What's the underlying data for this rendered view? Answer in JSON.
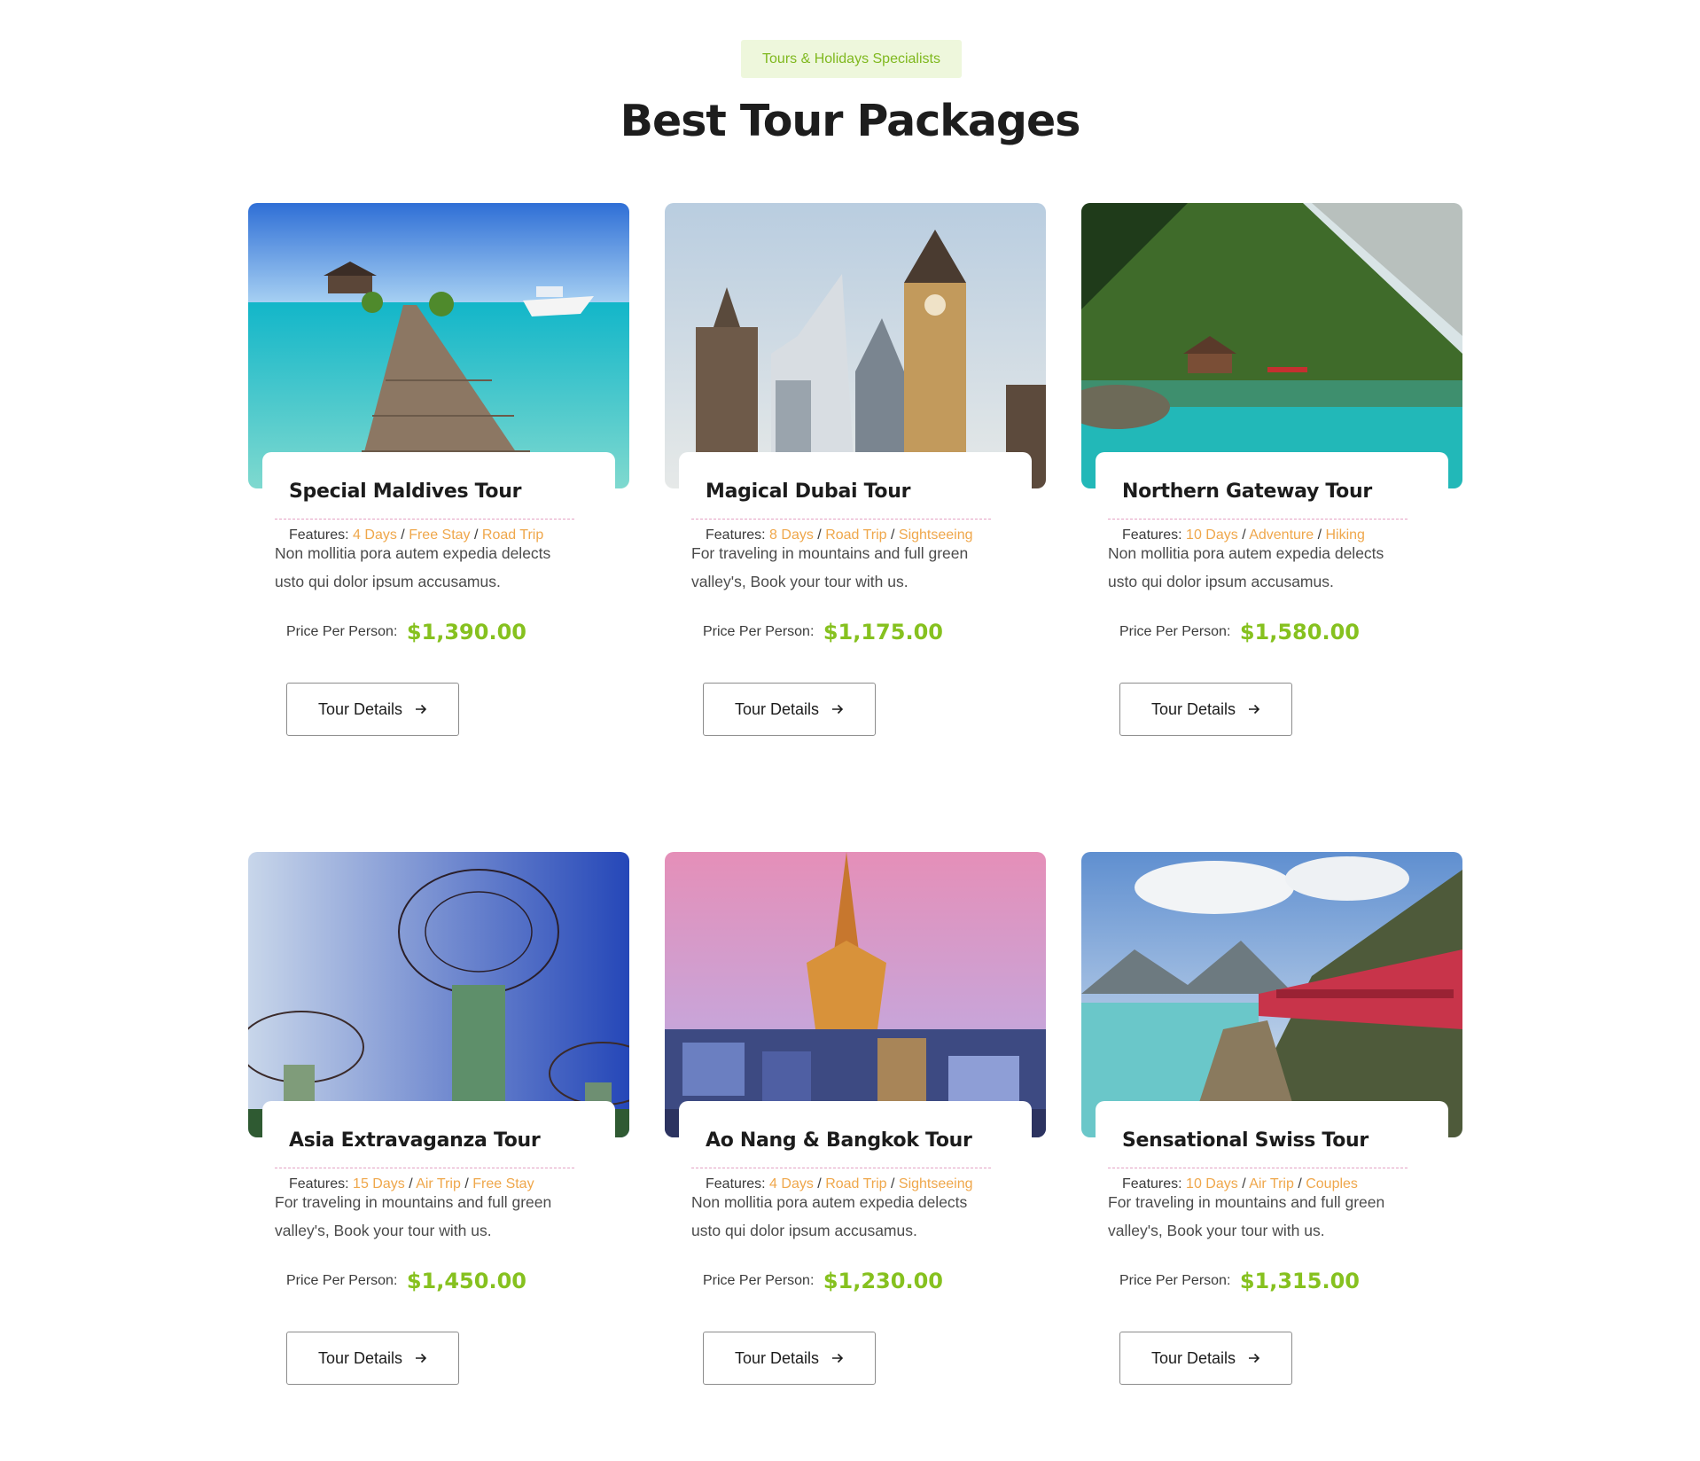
{
  "section": {
    "badge": "Tours & Holidays Specialists",
    "title": "Best Tour Packages"
  },
  "colors": {
    "accent_green": "#86c11f",
    "feature_orange": "#efa74b",
    "badge_bg": "#eef7dc"
  },
  "labels": {
    "features_prefix": "Features:",
    "price_label": "Price Per Person:",
    "button": "Tour Details"
  },
  "tours": [
    {
      "title": "Special Maldives Tour",
      "features": [
        "4 Days",
        "Free Stay",
        "Road Trip"
      ],
      "description": "Non mollitia pora autem expedia delects usto qui dolor ipsum accusamus.",
      "price": "$1,390.00",
      "image": "maldives-pier"
    },
    {
      "title": "Magical Dubai Tour",
      "features": [
        "8 Days",
        "Road Trip",
        "Sightseeing"
      ],
      "description": "For traveling in mountains and full green valley's, Book your tour with us.",
      "price": "$1,175.00",
      "image": "city-towers"
    },
    {
      "title": "Northern Gateway Tour",
      "features": [
        "10 Days",
        "Adventure",
        "Hiking"
      ],
      "description": "Non mollitia pora autem expedia delects usto qui dolor ipsum accusamus.",
      "price": "$1,580.00",
      "image": "mountain-lake"
    },
    {
      "title": "Asia Extravaganza Tour",
      "features": [
        "15 Days",
        "Air Trip",
        "Free Stay"
      ],
      "description": "For traveling in mountains and full green valley's, Book your tour with us.",
      "price": "$1,450.00",
      "image": "supertree-grove"
    },
    {
      "title": "Ao Nang & Bangkok Tour",
      "features": [
        "4 Days",
        "Road Trip",
        "Sightseeing"
      ],
      "description": "Non mollitia pora autem expedia delects usto qui dolor ipsum accusamus.",
      "price": "$1,230.00",
      "image": "bangkok-temple"
    },
    {
      "title": "Sensational Swiss Tour",
      "features": [
        "10 Days",
        "Air Trip",
        "Couples"
      ],
      "description": "For traveling in mountains and full green valley's, Book your tour with us.",
      "price": "$1,315.00",
      "image": "swiss-train"
    }
  ]
}
